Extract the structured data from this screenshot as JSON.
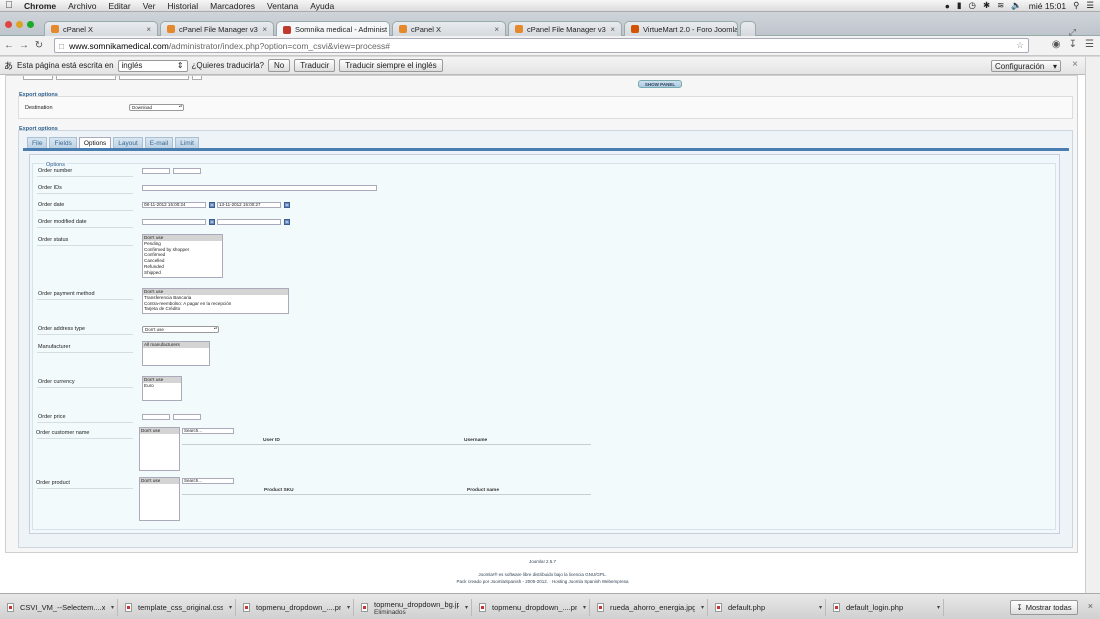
{
  "menubar": {
    "app": "Chrome",
    "items": [
      "Archivo",
      "Editar",
      "Ver",
      "Historial",
      "Marcadores",
      "Ventana",
      "Ayuda"
    ],
    "clock": "mié 15:01"
  },
  "tabs": [
    {
      "title": "cPanel X",
      "color": "#e58a2c"
    },
    {
      "title": "cPanel File Manager v3",
      "color": "#e58a2c"
    },
    {
      "title": "Somnika medical - Administ",
      "color": "#c0392b"
    },
    {
      "title": "cPanel X",
      "color": "#e58a2c"
    },
    {
      "title": "cPanel File Manager v3",
      "color": "#e58a2c"
    },
    {
      "title": "VirtueMart 2.0 - Foro Joomla",
      "color": "#d35400"
    }
  ],
  "url": {
    "host": "www.somnikamedical.com",
    "path": "/administrator/index.php?option=com_csvi&view=process#"
  },
  "translate": {
    "prefix": "Esta página está escrita en",
    "lang": "inglés",
    "question": "¿Quieres traducirla?",
    "no": "No",
    "translate": "Traducir",
    "always": "Traducir siempre el inglés",
    "config": "Configuración"
  },
  "page": {
    "show_panel": "SHOW PANEL",
    "export_options_1": "Export options",
    "destination_label": "Destination",
    "destination_value": "Download",
    "export_options_2": "Export options",
    "tabs": [
      "File",
      "Fields",
      "Options",
      "Layout",
      "E-mail",
      "Limit"
    ],
    "options_legend": "Options",
    "order_number": "Order number",
    "order_ids": "Order IDs",
    "order_date": "Order date",
    "order_date_from": "08-11-2012 15:00:24",
    "order_date_to": "13-11-2012 15:00:27",
    "order_modified_date": "Order modified date",
    "order_status": "Order status",
    "order_status_options": [
      "Don't use",
      "Pending",
      "Confirmed by shopper",
      "Confirmed",
      "Cancelled",
      "Refunded",
      "Shipped"
    ],
    "order_payment_method": "Order payment method",
    "payment_options": [
      "Don't use",
      "Transferencia Bancaria",
      "Contra-reembolso: A pagar en la recepción",
      "Tarjeta de Crédito"
    ],
    "order_address_type": "Order address type",
    "address_type_value": "Don't use",
    "manufacturer": "Manufacturer",
    "manufacturer_options": [
      "All manufacturers"
    ],
    "order_currency": "Order currency",
    "currency_options": [
      "Don't use",
      "Euro"
    ],
    "order_price": "Order price",
    "order_customer_name": "Order customer name",
    "customer_options": [
      "Don't use"
    ],
    "search_placeholder": "Search...",
    "col_user_id": "User ID",
    "col_username": "Username",
    "order_product": "Order product",
    "product_options": [
      "Don't use"
    ],
    "col_product_sku": "Product SKU",
    "col_product_name": "Product name"
  },
  "footer": {
    "version": "Joomla! 2.5.7",
    "line1": "Joomla!® es software libre distribuido bajo la licencia GNU/GPL.",
    "line2": "Pack creado por JoomlaSpanish - 2005-2012. · Hosting Joomla Spanish Webempresa"
  },
  "downloads": [
    {
      "name": "CSVI_VM_--Selectem....xml",
      "sub": ""
    },
    {
      "name": "template_css_original.css",
      "sub": ""
    },
    {
      "name": "topmenu_dropdown_....png",
      "sub": ""
    },
    {
      "name": "topmenu_dropdown_bg.jpg",
      "sub": "Eliminados"
    },
    {
      "name": "topmenu_dropdown_....png",
      "sub": ""
    },
    {
      "name": "rueda_ahorro_energia.jpg",
      "sub": ""
    },
    {
      "name": "default.php",
      "sub": ""
    },
    {
      "name": "default_login.php",
      "sub": ""
    }
  ],
  "show_all": "Mostrar todas"
}
